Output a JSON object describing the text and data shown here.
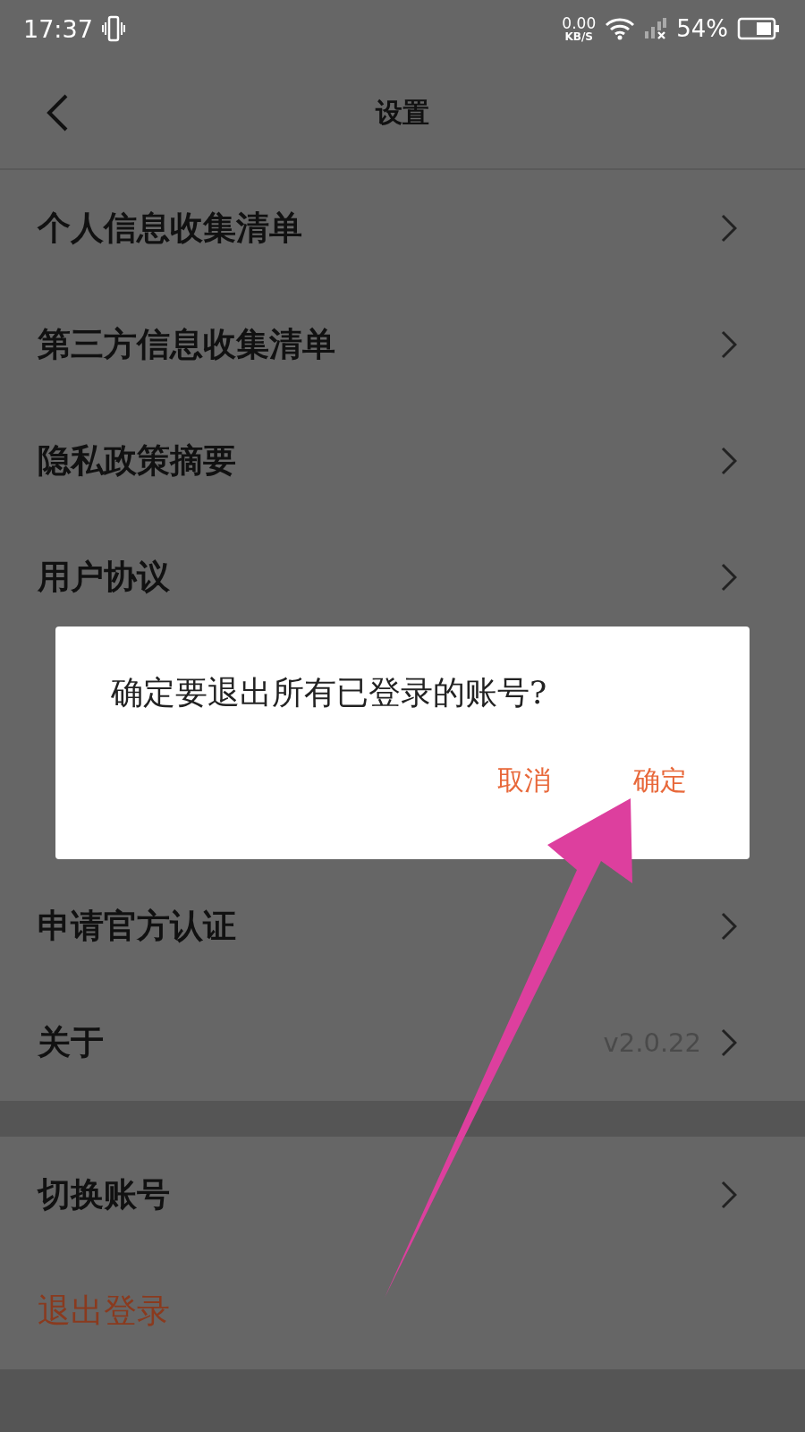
{
  "status_bar": {
    "time": "17:37",
    "speed_value": "0.00",
    "speed_unit": "KB/S",
    "battery": "54%"
  },
  "header": {
    "title": "设置"
  },
  "sections": [
    {
      "rows": [
        {
          "kind": "link",
          "label": "个人信息收集清单"
        },
        {
          "kind": "link",
          "label": "第三方信息收集清单"
        },
        {
          "kind": "link",
          "label": "隐私政策摘要"
        },
        {
          "kind": "link",
          "label": "用户协议"
        },
        {
          "kind": "covered"
        },
        {
          "kind": "covered"
        },
        {
          "kind": "link",
          "label": "申请官方认证"
        },
        {
          "kind": "link",
          "label": "关于",
          "value": "v2.0.22"
        }
      ]
    },
    {
      "rows": [
        {
          "kind": "link",
          "label": "切换账号"
        },
        {
          "kind": "danger",
          "label": "退出登录"
        }
      ]
    }
  ],
  "dialog": {
    "message": "确定要退出所有已登录的账号?",
    "buttons": [
      {
        "label": "取消"
      },
      {
        "label": "确定"
      }
    ]
  }
}
